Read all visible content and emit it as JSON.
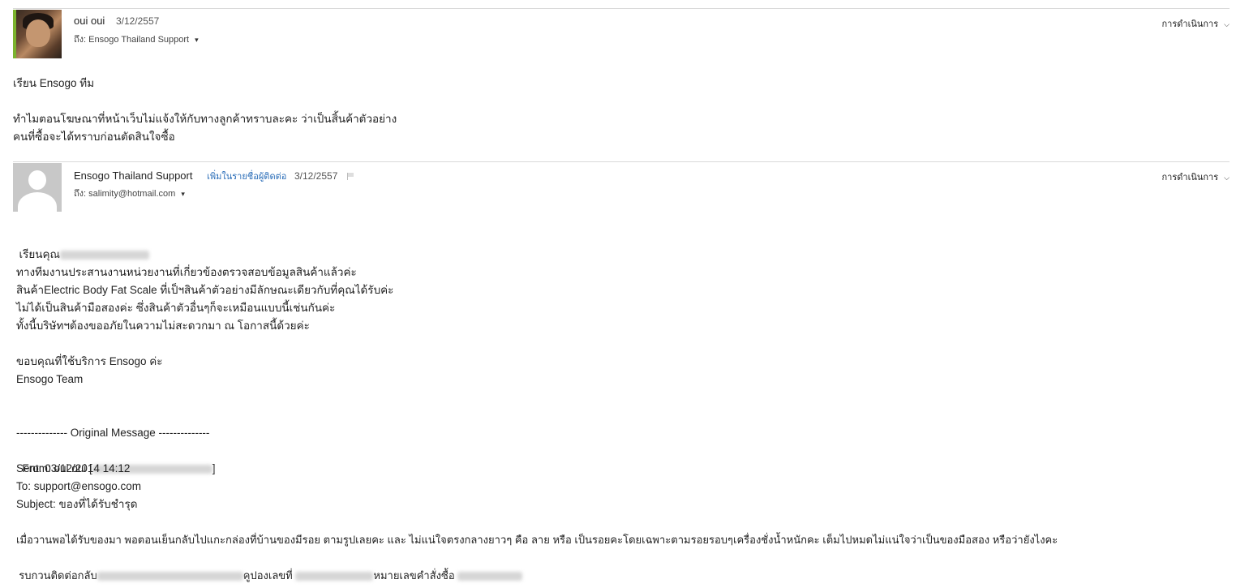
{
  "message1": {
    "sender": "oui oui",
    "date": "3/12/2557",
    "to_label": "ถึง:",
    "to": "Ensogo Thailand Support",
    "actions": "การดำเนินการ",
    "greeting": "เรียน Ensogo ทีม",
    "line1": "ทำไมตอนโฆษณาที่หน้าเว็บไม่แจ้งให้กับทางลูกค้าทราบละคะ ว่าเป็นสิ้นค้าตัวอย่าง",
    "line2": "คนที่ซื้อจะได้ทราบก่อนตัดสินใจซื้อ"
  },
  "message2": {
    "sender": "Ensogo Thailand Support",
    "add_contact": "เพิ่มในรายชื่อผู้ติดต่อ",
    "date": "3/12/2557",
    "to_label": "ถึง:",
    "to": "salimity@hotmail.com",
    "actions": "การดำเนินการ",
    "greeting": "เรียนคุณ",
    "p1": "ทางทีมงานประสานงานหน่วยงานที่เกี่ยวข้องตรวจสอบข้อมูลสินค้าแล้วค่ะ",
    "p2": "สินค้าElectric Body Fat Scale ที่เป็ฯสินค้าตัวอย่างมีลักษณะเดียวกับที่คุณได้รับค่ะ",
    "p3": "ไม่ได้เป็นสินค้ามือสองค่ะ ซึ่งสินค้าตัวอื่นๆก็จะเหมือนแบบนี้เช่นกันค่ะ",
    "p4": "ทั้งนี้บริษัทฯต้องขออภัยในความไม่สะดวกมา ณ โอกาสนี้ด้วยค่ะ",
    "thanks": "ขอบคุณที่ใช้บริการ Ensogo ค่ะ",
    "team": "Ensogo Team",
    "orig_header": "-------------- Original Message --------------",
    "from": "From: oui oui [",
    "from_end": "]",
    "sent": "Sent: 03/12/2014 14:12",
    "to_line": "To: support@ensogo.com",
    "subject": "Subject: ของที่ได้รับชำรุด",
    "orig_line1": "เมื่อวานพอได้รับของมา พอตอนเย็นกลับไปแกะกล่องที่บ้านของมีรอย ตามรูปเลยคะ และ ไม่แน่ใจตรงกลางยาวๆ คือ ลาย หรือ เป็นรอยคะโดยเฉพาะตามรอยรอบๆเครื่องชั่งน้ำหนักคะ เต็มไปหมดไม่แน่ใจว่าเป็นของมือสอง หรือว่ายังไงคะ",
    "orig_line2a": "รบกวนติดต่อกลับ",
    "orig_line2b": "คูปองเลขที่",
    "orig_line2c": "หมายเลขคำสั่งซื้อ"
  }
}
